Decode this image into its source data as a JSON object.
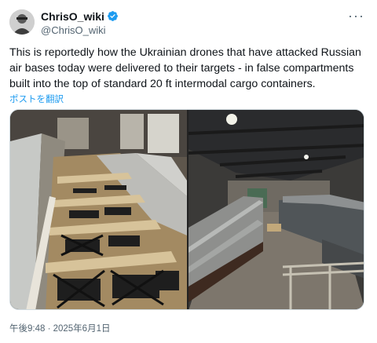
{
  "author": {
    "display_name": "ChrisO_wiki",
    "handle": "@ChrisO_wiki",
    "avatar_icon": "avatar-photo-icon",
    "verified_icon": "verified-badge-icon",
    "verified_color": "#1d9bf0"
  },
  "menu": {
    "more_label": "···"
  },
  "tweet": {
    "text": "This is reportedly how the Ukrainian drones that have attacked Russian air bases today were delivered to their targets - in false compartments built into the top of standard 20 ft intermodal cargo containers.",
    "translate_label": "ポストを翻訳"
  },
  "media": {
    "photos": [
      {
        "name": "drones-in-container-roof-photo"
      },
      {
        "name": "cargo-containers-in-warehouse-photo"
      }
    ]
  },
  "meta": {
    "timestamp": "午後9:48 · 2025年6月1日"
  },
  "colors": {
    "link": "#1d9bf0",
    "text": "#0f1419",
    "secondary": "#536471"
  }
}
